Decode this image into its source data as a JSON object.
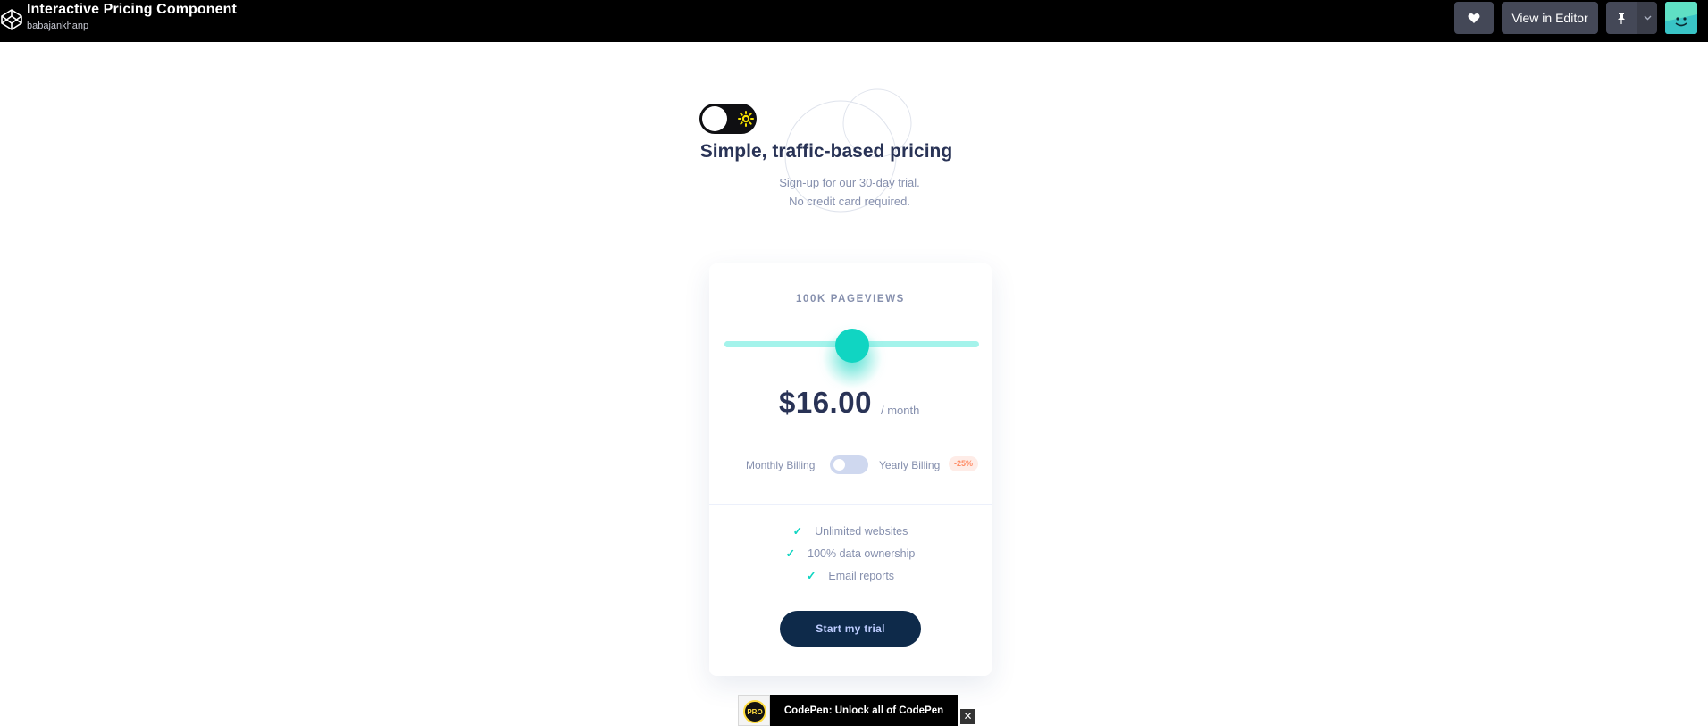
{
  "topbar": {
    "title": "Interactive Pricing Component",
    "author": "babajankhanp",
    "view_editor_label": "View in Editor",
    "icons": [
      "codepen-logo-icon",
      "heart-icon",
      "pin-icon",
      "chevron-down-icon",
      "avatar"
    ]
  },
  "hero": {
    "title": "Simple, traffic-based pricing",
    "subtitle_line1": "Sign-up for our 30-day trial.",
    "subtitle_line2": "No credit card required."
  },
  "card": {
    "pageviews_label": "100K PAGEVIEWS",
    "slider_value_fraction": 0.5,
    "price": "$16.00",
    "per_period": "/ month",
    "billing": {
      "monthly_label": "Monthly Billing",
      "yearly_label": "Yearly Billing",
      "discount_badge": "-25%",
      "yearly_enabled": false
    },
    "features": [
      "Unlimited websites",
      "100% data ownership",
      "Email reports"
    ],
    "cta_label": "Start my trial"
  },
  "promo": {
    "pro_badge": "PRO",
    "text": "CodePen: Unlock all of CodePen",
    "close_glyph": "✕"
  },
  "colors": {
    "topbar_bg": "#000000",
    "button_bg": "#444857",
    "title_text": "#293356",
    "muted_text": "#858fad",
    "slider_thumb": "#10d5c2",
    "slider_track": "#a4f3eb",
    "discount_text": "#ff8c66",
    "discount_bg": "#feece7",
    "cta_bg": "#0e2a4a"
  }
}
